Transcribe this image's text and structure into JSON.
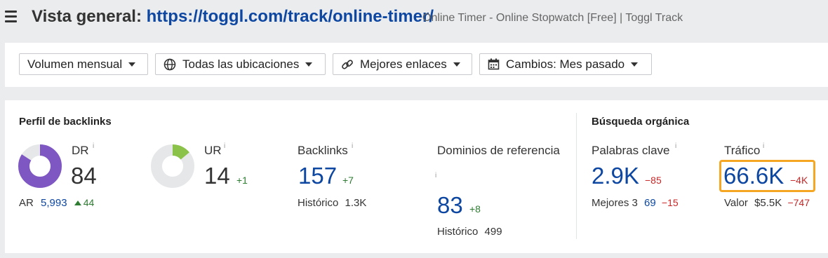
{
  "header": {
    "title_prefix": "Vista general:",
    "url": "https://toggl.com/track/online-timer/",
    "page_title": "Online Timer - Online Stopwatch [Free] | Toggl Track"
  },
  "filters": [
    {
      "label": "Volumen mensual",
      "icon": ""
    },
    {
      "label": "Todas las ubicaciones",
      "icon": "globe-icon"
    },
    {
      "label": "Mejores enlaces",
      "icon": "link-icon"
    },
    {
      "label": "Cambios: Mes pasado",
      "icon": "calendar-icon"
    }
  ],
  "backlinks": {
    "section_title": "Perfil de backlinks",
    "dr": {
      "label": "DR",
      "value": "84",
      "fill_percent": 84,
      "color": "#7e57c2"
    },
    "ar": {
      "label": "AR",
      "value": "5,993",
      "change": "44"
    },
    "ur": {
      "label": "UR",
      "value": "14",
      "change": "+1",
      "fill_percent": 14,
      "color": "#8bc34a"
    },
    "backlinks": {
      "label": "Backlinks",
      "value": "157",
      "change": "+7",
      "history_label": "Histórico",
      "history_value": "1.3K"
    },
    "ref_domains": {
      "label": "Dominios de referencia",
      "value": "83",
      "change": "+8",
      "history_label": "Histórico",
      "history_value": "499"
    }
  },
  "organic": {
    "section_title": "Búsqueda orgánica",
    "keywords": {
      "label": "Palabras clave",
      "value": "2.9K",
      "change": "−85",
      "top3_label": "Mejores 3",
      "top3_value": "69",
      "top3_change": "−15"
    },
    "traffic": {
      "label": "Tráfico",
      "value": "66.6K",
      "change": "−4K",
      "value_label": "Valor",
      "value_amount": "$5.5K",
      "value_change": "−747"
    }
  },
  "info_glyph": "i",
  "colors": {
    "accent_blue": "#0d47a1",
    "positive": "#2e7d32",
    "negative": "#c62828",
    "highlight": "#f5a623"
  }
}
